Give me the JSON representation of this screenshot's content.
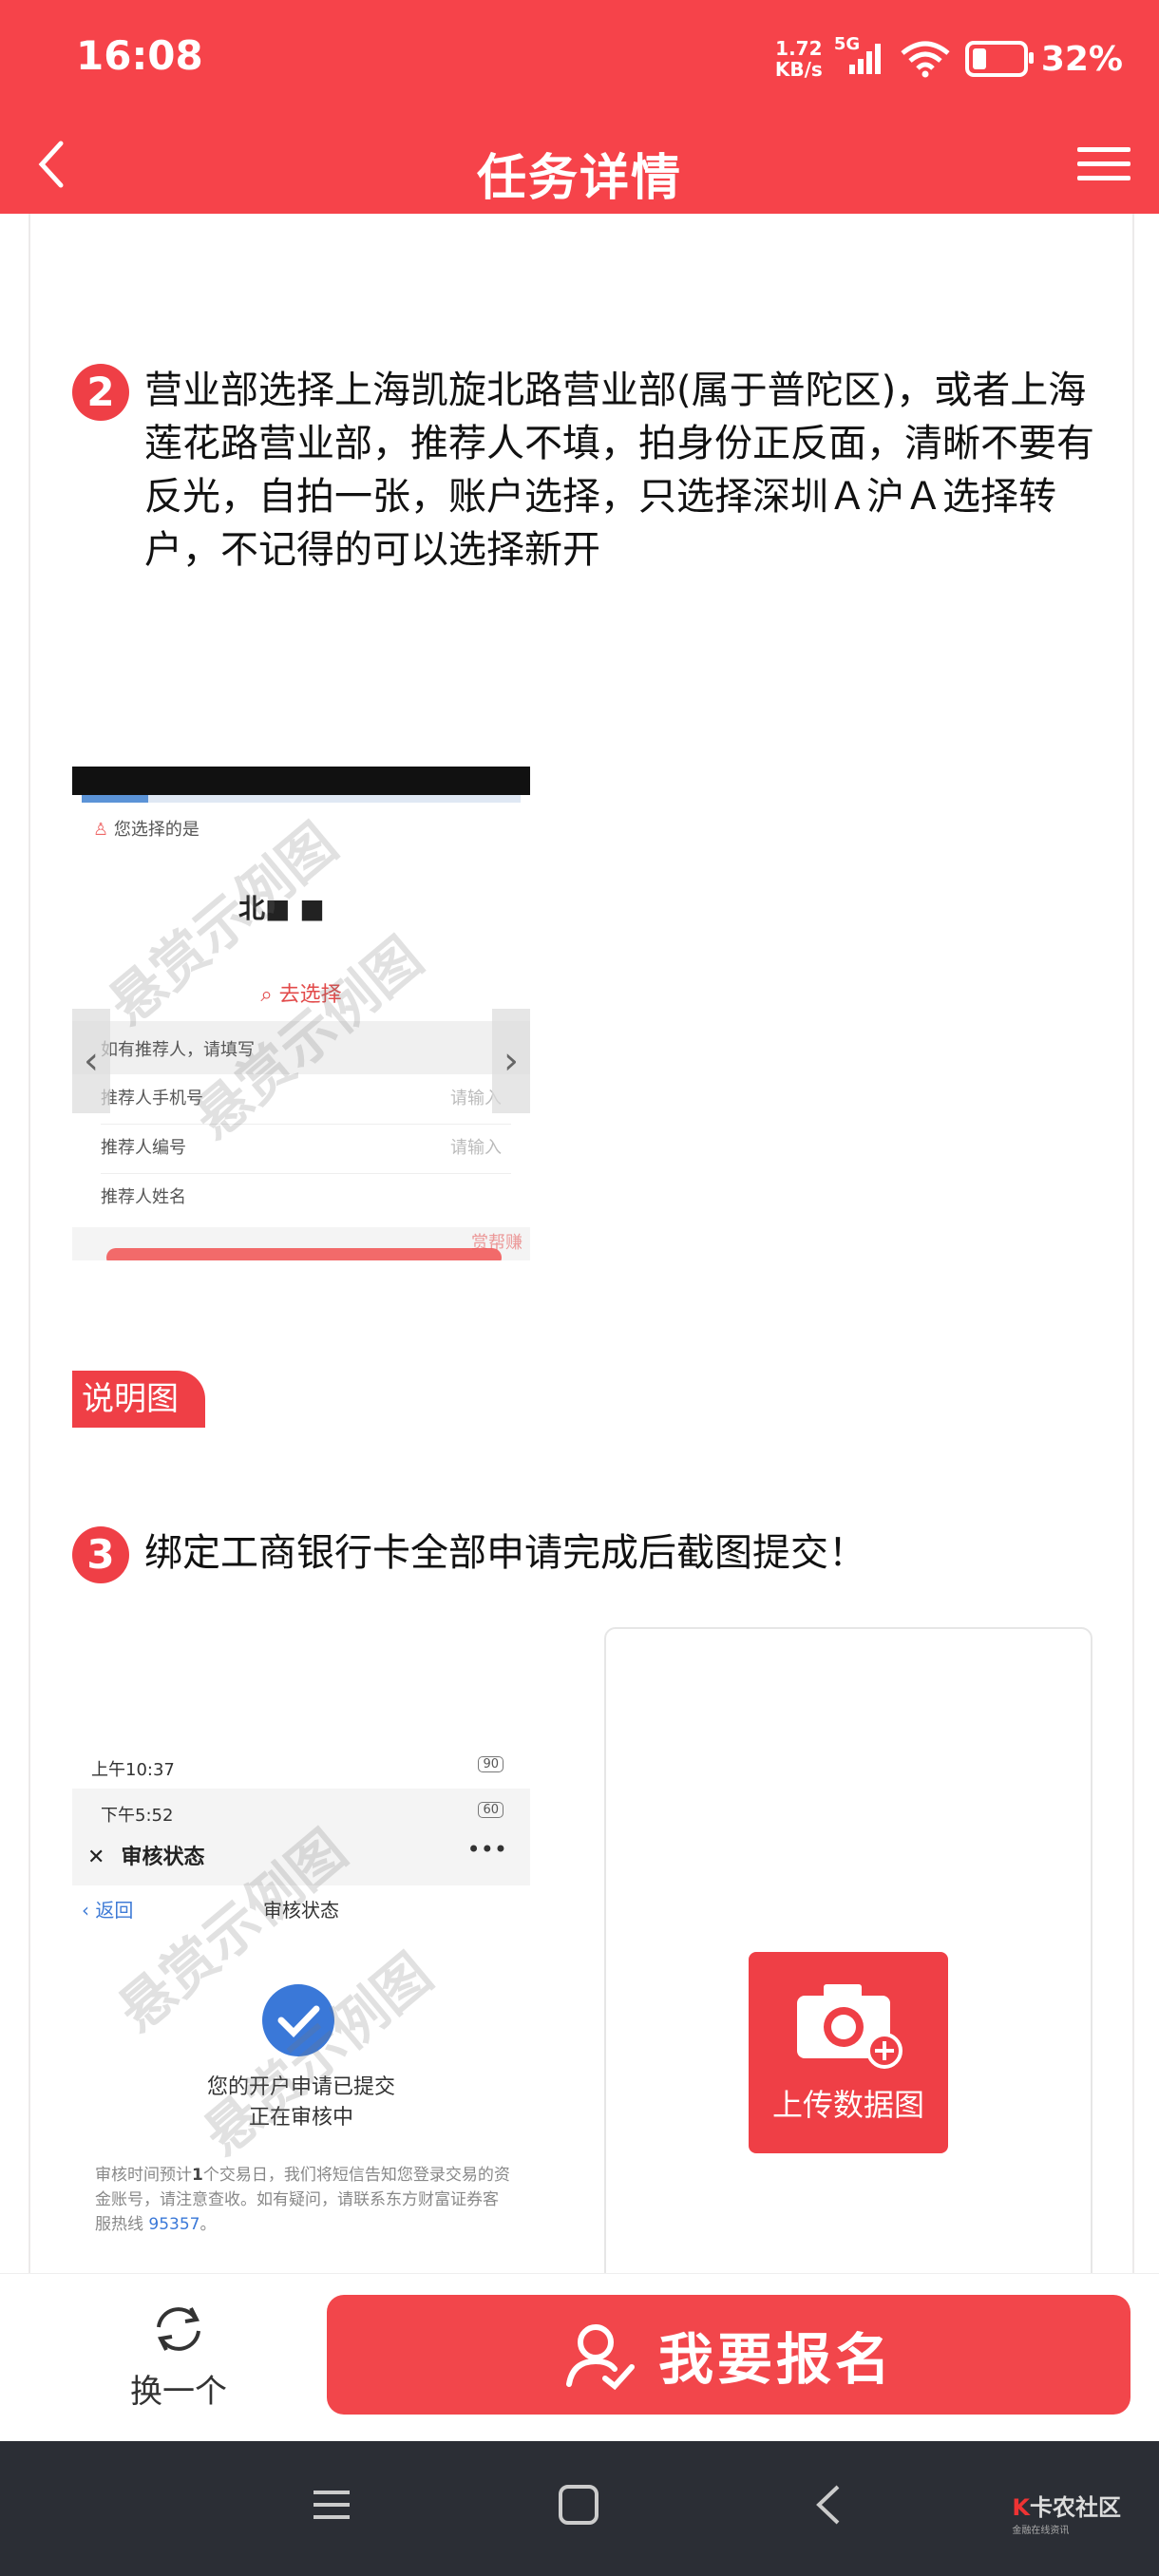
{
  "status_bar": {
    "time": "16:08",
    "net_speed_value": "1.72",
    "net_speed_unit": "KB/s",
    "network_type": "5G",
    "battery": "32%"
  },
  "nav": {
    "title": "任务详情"
  },
  "steps": [
    {
      "number": "2",
      "text": "营业部选择上海凯旋北路营业部(属于普陀区)，或者上海莲花路营业部，推荐人不填，拍身份正反面，清晰不要有反光，自拍一张，账户选择，只选择深圳Ａ沪Ａ选择转户，不记得的可以选择新开"
    },
    {
      "number": "3",
      "text": "绑定工商银行卡全部申请完成后截图提交！"
    }
  ],
  "example1": {
    "watermark": "悬赏示例图",
    "selected_label": "您选择的是",
    "selected_value": "北■ ■",
    "choose_link": "去选择",
    "referrer_hint": "如有推荐人，请填写",
    "rows": [
      {
        "label": "推荐人手机号",
        "placeholder": "请输入"
      },
      {
        "label": "推荐人编号",
        "placeholder": "请输入"
      },
      {
        "label": "推荐人姓名",
        "placeholder": ""
      }
    ],
    "corner_text": "赏帮赚"
  },
  "explain_tag": "说明图",
  "example2": {
    "watermark": "悬赏示例图",
    "time1": "上午10:37",
    "time2": "下午5:52",
    "battery1": "90",
    "battery2": "60",
    "header_title": "审核状态",
    "back_label": "返回",
    "sub_title": "审核状态",
    "status_line1": "您的开户申请已提交",
    "status_line2": "正在审核中",
    "note_pre": "审核时间预计",
    "note_bold": "1",
    "note_mid": "个交易日，我们将短信告知您登录交易的资金账号，请注意查收。如有疑问，请联系东方财富证券客服热线 ",
    "note_phone": "95357",
    "note_end": "。"
  },
  "upload": {
    "label": "上传数据图"
  },
  "bottom": {
    "swap_label": "换一个",
    "signup_label": "我要报名"
  },
  "brand": {
    "name": "卡农社区",
    "sub": "金融在线资讯"
  },
  "colors": {
    "primary": "#f6434a",
    "nav_dark": "#2b2e35"
  }
}
